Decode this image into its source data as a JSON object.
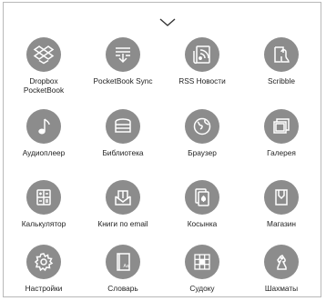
{
  "apps": [
    {
      "label": "Dropbox\nPocketBook",
      "icon": "dropbox-icon"
    },
    {
      "label": "PocketBook Sync",
      "icon": "sync-icon"
    },
    {
      "label": "RSS Новости",
      "icon": "rss-icon"
    },
    {
      "label": "Scribble",
      "icon": "scribble-icon"
    },
    {
      "label": "Аудиоплеер",
      "icon": "music-note-icon"
    },
    {
      "label": "Библиотека",
      "icon": "library-icon"
    },
    {
      "label": "Браузер",
      "icon": "globe-icon"
    },
    {
      "label": "Галерея",
      "icon": "gallery-icon"
    },
    {
      "label": "Калькулятор",
      "icon": "calculator-icon"
    },
    {
      "label": "Книги по email",
      "icon": "email-books-icon"
    },
    {
      "label": "Косынка",
      "icon": "cards-icon"
    },
    {
      "label": "Магазин",
      "icon": "shop-icon"
    },
    {
      "label": "Настройки",
      "icon": "gear-icon"
    },
    {
      "label": "Словарь",
      "icon": "dictionary-icon"
    },
    {
      "label": "Судоку",
      "icon": "sudoku-icon"
    },
    {
      "label": "Шахматы",
      "icon": "chess-knight-icon"
    }
  ]
}
